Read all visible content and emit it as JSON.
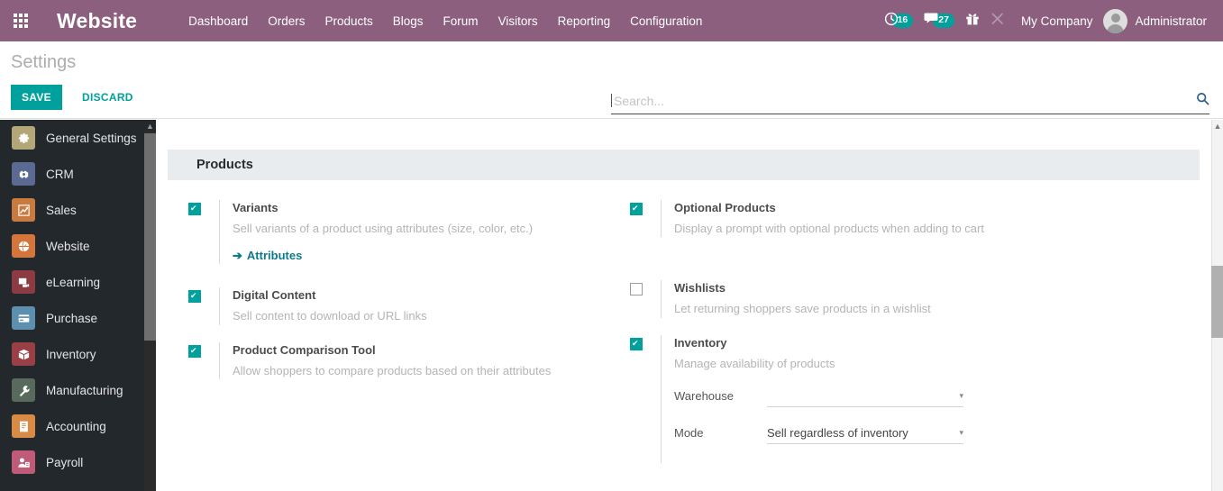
{
  "navbar": {
    "apps_icon": "apps-grid-icon",
    "brand": "Website",
    "menu_items": [
      {
        "label": "Dashboard"
      },
      {
        "label": "Orders"
      },
      {
        "label": "Products"
      },
      {
        "label": "Blogs"
      },
      {
        "label": "Forum"
      },
      {
        "label": "Visitors"
      },
      {
        "label": "Reporting"
      },
      {
        "label": "Configuration"
      }
    ],
    "systray": {
      "activities_icon": "clock-icon",
      "activities_count": "16",
      "messages_icon": "chat-bubble-icon",
      "messages_count": "27",
      "gift_icon": "gift-icon",
      "tools_icon": "wrench-icon",
      "company": "My Company",
      "user": "Administrator",
      "avatar": "user-avatar"
    },
    "accent": "#8b5f7d",
    "badge_color": "#00A09D"
  },
  "control_panel": {
    "title": "Settings",
    "save_label": "SAVE",
    "discard_label": "DISCARD",
    "save_color": "#00A09D",
    "search": {
      "value": "",
      "placeholder": "Search...",
      "icon": "magnifier-icon"
    }
  },
  "sidebar": {
    "scroll_up_arrow": "▲",
    "items": [
      {
        "label": "General Settings",
        "icon": "gear-icon",
        "glyph": "⚙",
        "bg": "#b3a77a"
      },
      {
        "label": "CRM",
        "icon": "handshake-icon",
        "glyph": "✇",
        "bg": "#5b6a93"
      },
      {
        "label": "Sales",
        "icon": "chart-line-icon",
        "glyph": "📈",
        "bg": "#c87a3f"
      },
      {
        "label": "Website",
        "icon": "globe-icon",
        "glyph": "🌐",
        "bg": "#d4763c"
      },
      {
        "label": "eLearning",
        "icon": "presentation-icon",
        "glyph": "🎓",
        "bg": "#8c3b42"
      },
      {
        "label": "Purchase",
        "icon": "card-icon",
        "glyph": "▤",
        "bg": "#5d8fae"
      },
      {
        "label": "Inventory",
        "icon": "box-icon",
        "glyph": "📦",
        "bg": "#993f45"
      },
      {
        "label": "Manufacturing",
        "icon": "wrench-icon",
        "glyph": "🔧",
        "bg": "#586a5c"
      },
      {
        "label": "Accounting",
        "icon": "invoice-icon",
        "glyph": "🧾",
        "bg": "#d98b46"
      },
      {
        "label": "Payroll",
        "icon": "employee-icon",
        "glyph": "👤",
        "bg": "#bf5b78"
      }
    ]
  },
  "main": {
    "section_title": "Products",
    "left_settings": [
      {
        "label": "Variants",
        "help": "Sell variants of a product using attributes (size, color, etc.)",
        "checked": true,
        "link": "Attributes",
        "link_arrow": "➔"
      },
      {
        "label": "Digital Content",
        "help": "Sell content to download or URL links",
        "checked": true
      },
      {
        "label": "Product Comparison Tool",
        "help": "Allow shoppers to compare products based on their attributes",
        "checked": true
      }
    ],
    "right_settings": [
      {
        "label": "Optional Products",
        "help": "Display a prompt with optional products when adding to cart",
        "checked": true
      },
      {
        "label": "Wishlists",
        "help": "Let returning shoppers save products in a wishlist",
        "checked": false
      },
      {
        "label": "Inventory",
        "help": "Manage availability of products",
        "checked": true,
        "fields": [
          {
            "label": "Warehouse",
            "value": "",
            "placeholder": "",
            "caret": "▾"
          },
          {
            "label": "Mode",
            "value": "Sell regardless of inventory",
            "placeholder": "",
            "caret": "▾"
          }
        ]
      }
    ]
  },
  "scrollbar": {
    "up_arrow": "▲"
  }
}
